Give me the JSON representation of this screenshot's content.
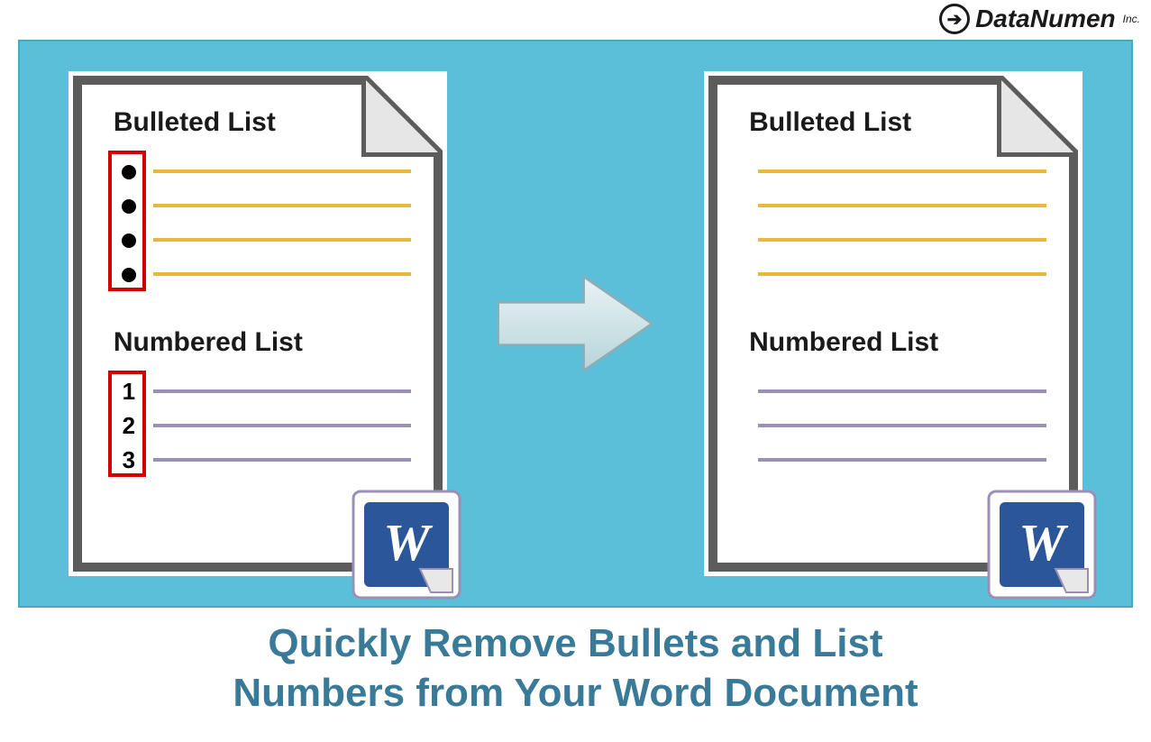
{
  "brand": {
    "name": "DataNumen",
    "suffix": "Inc."
  },
  "left_doc": {
    "bulleted_title": "Bulleted List",
    "numbered_title": "Numbered List",
    "numbers": [
      "1",
      "2",
      "3"
    ]
  },
  "right_doc": {
    "bulleted_title": "Bulleted List",
    "numbered_title": "Numbered List"
  },
  "caption_line1": "Quickly Remove Bullets and List",
  "caption_line2": "Numbers from Your Word Document",
  "colors": {
    "panel_bg": "#5bbfd9",
    "caption_text": "#3a7a99",
    "line_yellow": "#e8b83a",
    "line_purple": "#9a8fb5",
    "highlight_red": "#d40000",
    "doc_border": "#5c5c5c"
  },
  "word_icon_letter": "W"
}
